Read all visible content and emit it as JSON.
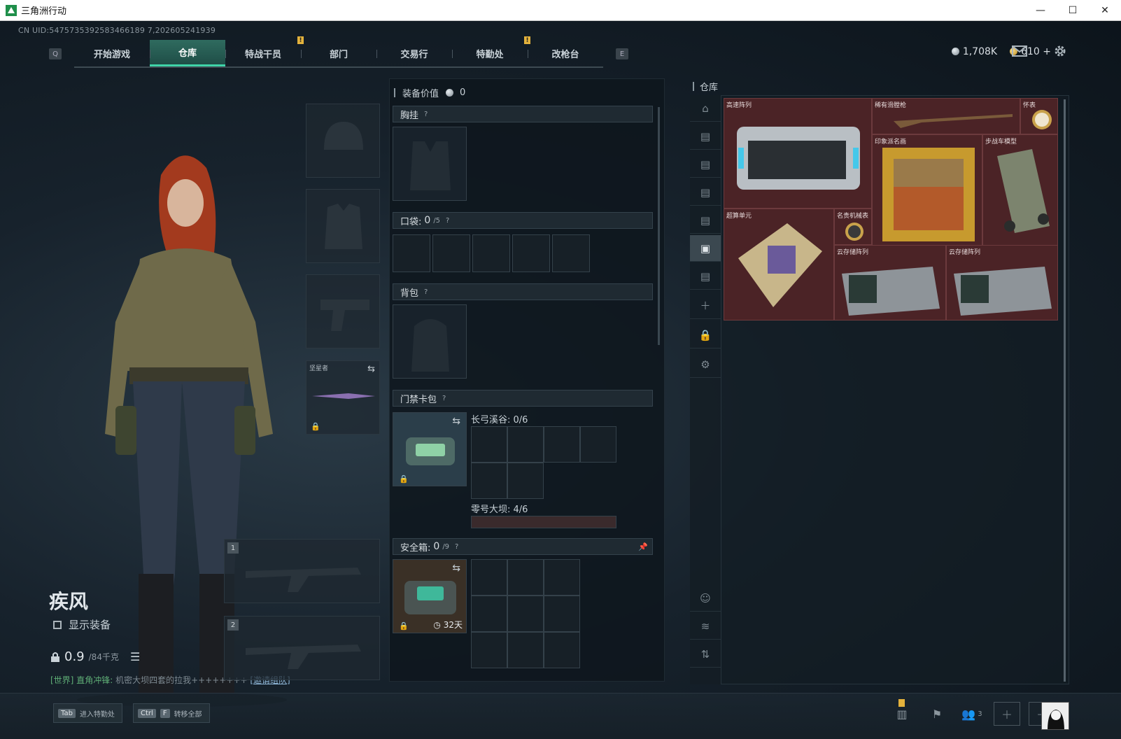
{
  "window": {
    "title": "三角洲行动",
    "minimize": "—",
    "maximize": "☐",
    "close": "✕"
  },
  "uid": "CN UID:5475735392583466189 7,202605241939",
  "nav": {
    "key_left": "Q",
    "key_right": "E",
    "tabs": [
      {
        "label": "开始游戏",
        "alert": false
      },
      {
        "label": "仓库",
        "alert": false,
        "active": true
      },
      {
        "label": "特战干员",
        "alert": true
      },
      {
        "label": "部门",
        "alert": false
      },
      {
        "label": "交易行",
        "alert": false
      },
      {
        "label": "特勤处",
        "alert": true
      },
      {
        "label": "改枪台",
        "alert": false
      }
    ],
    "alert_mark": "!"
  },
  "currency": {
    "silver": "1,708K",
    "gold": "610",
    "add": "+"
  },
  "icons": {
    "mail": "mail-icon",
    "settings": "gear-icon"
  },
  "character": {
    "name": "疾风",
    "show_gear_label": "显示装备",
    "weight_value": "0.9",
    "weight_max": "/84千克"
  },
  "chat": {
    "channel": "[世界]",
    "player": "直角冲锋:",
    "message": " 机密大坝四套的拉我++++++++ ",
    "invite": "[邀请组队]"
  },
  "equipment": {
    "melee_label": "坚星者",
    "weapon_slot_1": "1",
    "weapon_slot_2": "2"
  },
  "loadout": {
    "value_label": "装备价值",
    "value": "0",
    "chest_label": "胸挂",
    "pocket_label": "口袋:",
    "pocket_count": "0",
    "pocket_capacity": "/5",
    "backpack_label": "背包",
    "keycard_label": "门禁卡包",
    "keycard_map1": "长弓溪谷: 0/6",
    "keycard_map2": "零号大坝: 4/6",
    "safe_label": "安全箱:",
    "safe_count": "0",
    "safe_capacity": "/9",
    "safe_days": "32天",
    "help_mark": "?"
  },
  "storage": {
    "title": "仓库",
    "items": [
      {
        "name": "高速阵列"
      },
      {
        "name": "稀有滑膛枪"
      },
      {
        "name": "怀表"
      },
      {
        "name": "印象派名画"
      },
      {
        "name": "步战车模型"
      },
      {
        "name": "超算单元"
      },
      {
        "name": "名贵机械表"
      },
      {
        "name": "云存储阵列"
      },
      {
        "name": "云存储阵列"
      }
    ]
  },
  "bottom": {
    "hotkey1_key": "Tab",
    "hotkey1_label": "进入特勤处",
    "hotkey2_key1": "Ctrl",
    "hotkey2_key2": "F",
    "hotkey2_label": "转移全部",
    "friends_count": "3"
  },
  "colors": {
    "accent": "#3fd4a8",
    "alert": "#e3b23c",
    "item_bg": "#4b2326"
  }
}
